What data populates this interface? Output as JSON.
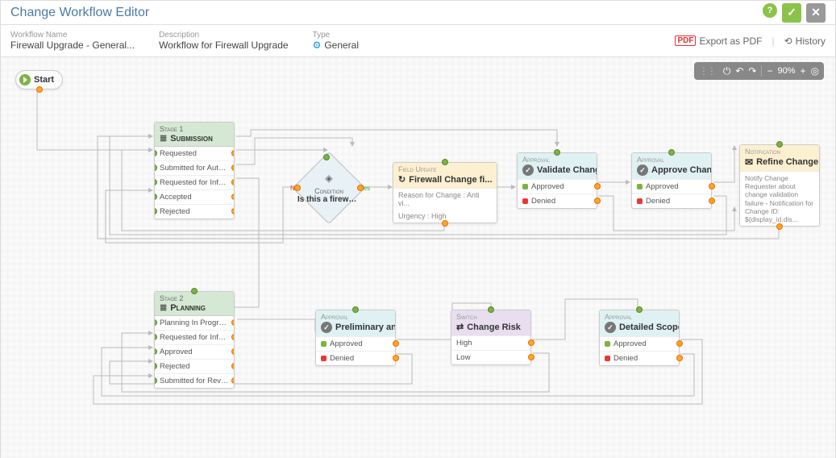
{
  "header": {
    "title": "Change Workflow Editor"
  },
  "meta": {
    "name_label": "Workflow Name",
    "name_value": "Firewall Upgrade - General...",
    "desc_label": "Description",
    "desc_value": "Workflow for Firewall Upgrade",
    "type_label": "Type",
    "type_value": "General",
    "export_pdf": "Export as PDF",
    "history": "History"
  },
  "toolbar": {
    "zoom": "90%"
  },
  "start": {
    "label": "Start"
  },
  "condition": {
    "cat": "Condition",
    "q": "Is this a firewall ...",
    "no": "No",
    "yes": "Yes"
  },
  "stage1": {
    "num": "Stage 1",
    "name": "Submission",
    "rows": [
      "Requested",
      "Submitted for Authoriza...",
      "Requested for Informat...",
      "Accepted",
      "Rejected"
    ]
  },
  "stage2": {
    "num": "Stage 2",
    "name": "Planning",
    "rows": [
      "Planning In Progress",
      "Requested for Informat...",
      "Approved",
      "Rejected",
      "Submitted for Review"
    ]
  },
  "fieldupdate": {
    "cat": "Field Update",
    "name": "Firewall Change fi...",
    "sub1": "Reason for Change : Anti vi...",
    "sub2": "Urgency : High"
  },
  "approval1": {
    "cat": "Approval",
    "name": "Validate Change ...",
    "approved": "Approved",
    "denied": "Denied"
  },
  "approval2": {
    "cat": "Approval",
    "name": "Approve Change ...",
    "approved": "Approved",
    "denied": "Denied"
  },
  "approval3": {
    "cat": "Approval",
    "name": "Preliminary analy...",
    "approved": "Approved",
    "denied": "Denied"
  },
  "approval4": {
    "cat": "Approval",
    "name": "Detailed Scope of...",
    "approved": "Approved",
    "denied": "Denied"
  },
  "switch": {
    "cat": "Switch",
    "name": "Change Risk",
    "high": "High",
    "low": "Low"
  },
  "notification": {
    "cat": "Notification",
    "name": "Refine Change &...",
    "desc": "Notify Change Requester about change validation failure - Notification for Change ID: ${display_id.dis..."
  }
}
